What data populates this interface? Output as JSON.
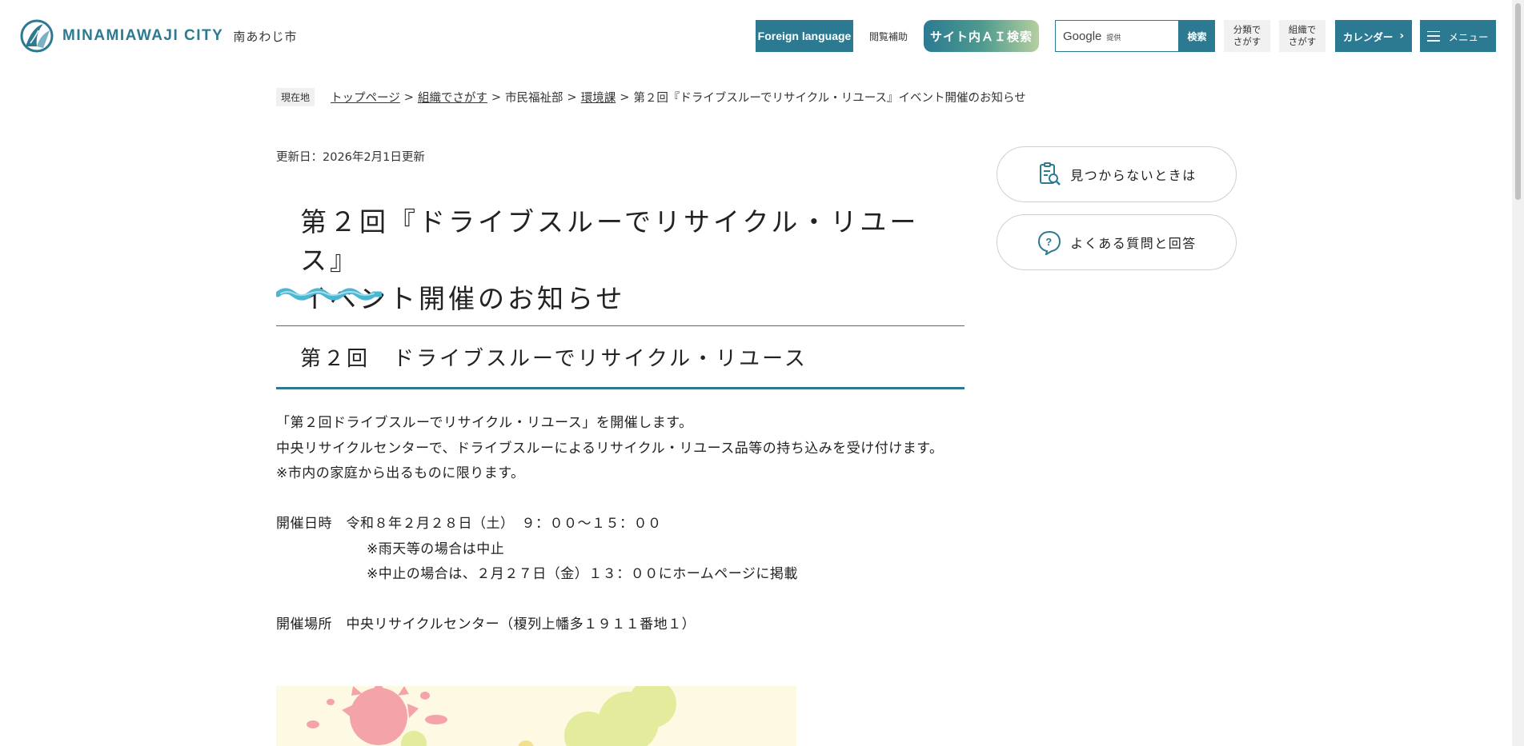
{
  "header": {
    "logo_en": "MINAMIAWAJI CITY",
    "logo_jp": "南あわじ市",
    "foreign_language": "Foreign language",
    "browse_assist": "閲覧補助",
    "ai_search": "サイト内ＡＩ検索",
    "search_google": "Google",
    "search_provided": "提供",
    "search_button": "検索",
    "by_category_line1": "分類で",
    "by_category_line2": "さがす",
    "by_org_line1": "組織で",
    "by_org_line2": "さがす",
    "calendar": "カレンダー",
    "menu": "メニュー"
  },
  "breadcrumb": {
    "here_label": "現在地",
    "items": [
      {
        "label": "トップページ",
        "link": true
      },
      {
        "label": "組織でさがす",
        "link": true
      },
      {
        "label": "市民福祉部",
        "link": false
      },
      {
        "label": "環境課",
        "link": true
      },
      {
        "label": "第２回『ドライブスルーでリサイクル・リユース』イベント開催のお知らせ",
        "link": false
      }
    ],
    "separator": ">"
  },
  "article": {
    "updated": "更新日：2026年2月1日更新",
    "title_line1": "第２回『ドライブスルーでリサイクル・リユース』",
    "title_line2": "イベント開催のお知らせ",
    "section_heading": "第２回　ドライブスルーでリサイクル・リユース",
    "p1": "「第２回ドライブスルーでリサイクル・リユース」を開催します。",
    "p2": "中央リサイクルセンターで、ドライブスルーによるリサイクル・リユース品等の持ち込みを受け付けます。",
    "p3": "※市内の家庭から出るものに限ります。",
    "date_line": "開催日時　令和８年２月２８日（土）　９：００～１５：００",
    "date_note1": "※雨天等の場合は中止",
    "date_note2": "※中止の場合は、２月２７日（金）１３：００にホームページに掲載",
    "venue_line": "開催場所　中央リサイクルセンター（榎列上幡多１９１１番地１）"
  },
  "sidebar": {
    "not_found": "見つからないときは",
    "faq": "よくある質問と回答"
  },
  "colors": {
    "brand": "#2c7a92",
    "wave": "#4bb6d2"
  }
}
